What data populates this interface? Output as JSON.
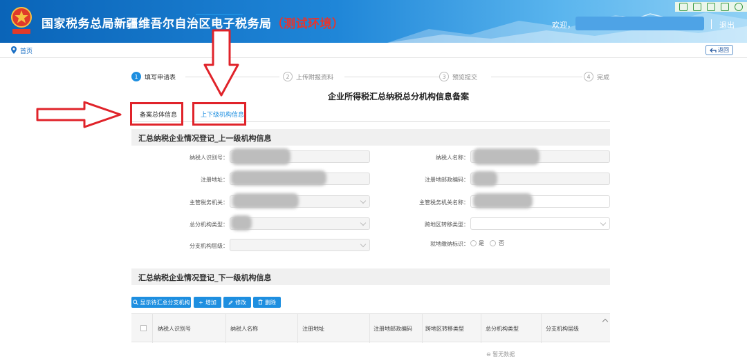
{
  "header": {
    "title_main": "国家税务总局新疆维吾尔自治区电子税务局",
    "title_env": "（测试环境）",
    "welcome": "欢迎，",
    "logout": "退出",
    "window_icons": [
      "window-icon",
      "expand-icon",
      "qr-icon",
      "export-icon",
      "settings-icon"
    ],
    "colors": {
      "brand": "#0a64b8",
      "env": "#e8352c"
    }
  },
  "breadcrumb": {
    "home": "首页",
    "back": "返回"
  },
  "steps": [
    {
      "num": "1",
      "label": "填写申请表",
      "active": true
    },
    {
      "num": "2",
      "label": "上传附报资料",
      "active": false
    },
    {
      "num": "3",
      "label": "预览提交",
      "active": false
    },
    {
      "num": "4",
      "label": "完成",
      "active": false
    }
  ],
  "page_title": "企业所得税汇总纳税总分机构信息备案",
  "tabs": [
    {
      "label": "备案总体信息",
      "active": false
    },
    {
      "label": "上下级机构信息",
      "active": true
    }
  ],
  "section_upper": {
    "title": "汇总纳税企业情况登记_上一级机构信息",
    "fields": {
      "taxpayer_id": "纳税人识别号：",
      "taxpayer_name": "纳税人名称：",
      "reg_address": "注册地址：",
      "reg_postcode": "注册地邮政编码：",
      "tax_authority": "主管税务机关：",
      "tax_authority_name": "主管税务机关名称：",
      "branch_type": "总分机构类型：",
      "cross_region_type": "跨地区转移类型：",
      "branch_level": "分支机构层级：",
      "local_tax_flag": "就地缴纳标识：",
      "radio_yes": "是",
      "radio_no": "否"
    }
  },
  "section_lower": {
    "title": "汇总纳税企业情况登记_下一级机构信息",
    "toolbar": {
      "show_branches": "显示待汇总分支机构",
      "add": "增加",
      "edit": "修改",
      "delete": "删除"
    },
    "columns": [
      "纳税人识别号",
      "纳税人名称",
      "注册地址",
      "注册地邮政编码",
      "跨地区转移类型",
      "总分机构类型",
      "分支机构层级"
    ],
    "empty_text": "暂无数据"
  }
}
